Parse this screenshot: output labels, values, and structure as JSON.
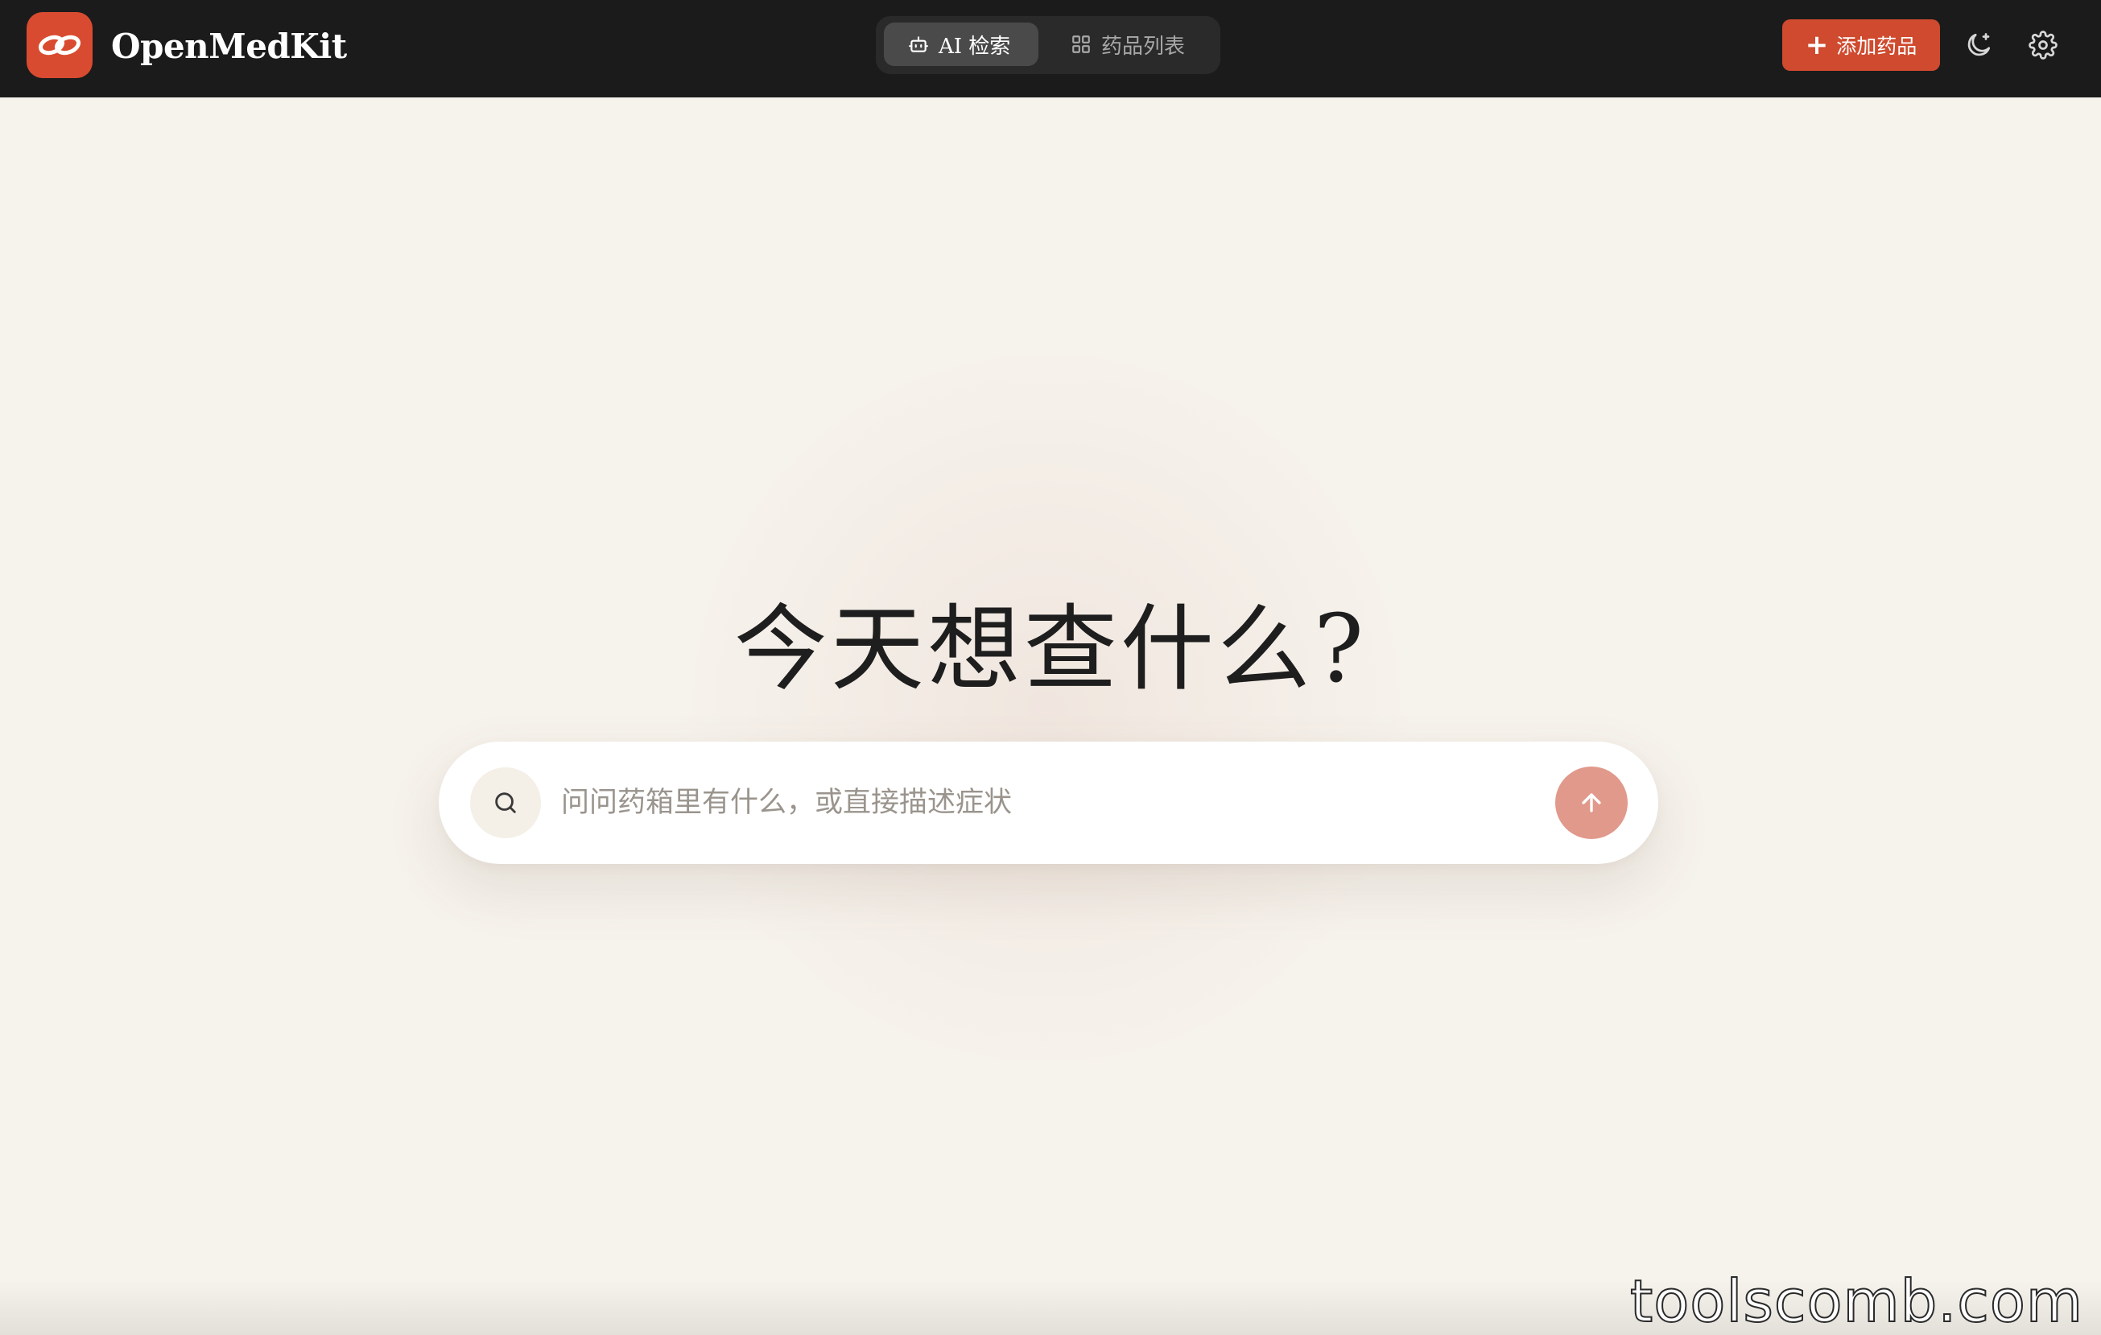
{
  "header": {
    "brand": "OpenMedKit",
    "logo_icon": "pill-capsule-icon",
    "tabs": [
      {
        "label": "AI 检索",
        "icon": "robot-icon",
        "active": true
      },
      {
        "label": "药品列表",
        "icon": "grid-icon",
        "active": false
      }
    ],
    "add_button_label": "添加药品",
    "theme_toggle_icon": "moon-icon",
    "settings_icon": "gear-icon"
  },
  "main": {
    "heading": "今天想查什么?",
    "search": {
      "placeholder": "问问药箱里有什么，或直接描述症状",
      "value": ""
    }
  },
  "watermark": "toolscomb.com",
  "colors": {
    "topbar": "#1b1b1b",
    "accent": "#cf4a2e",
    "background": "#f6f2ec",
    "send_button": "#e1998b"
  }
}
